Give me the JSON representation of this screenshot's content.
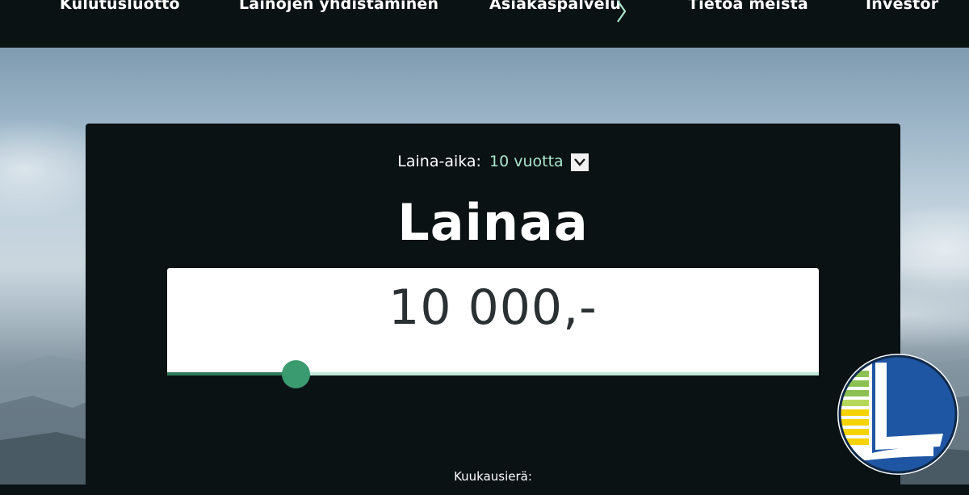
{
  "nav": {
    "items": [
      {
        "label": "Kulutusluotto"
      },
      {
        "label": "Lainojen yhdistäminen"
      },
      {
        "label": "Asiakaspalvelu"
      },
      {
        "label": "Tietoa meistä"
      },
      {
        "label": "Investor"
      }
    ],
    "chevron_icon": "chevron-right-icon",
    "chevron_color": "#a9e5cc"
  },
  "calculator": {
    "term_label": "Laina-aika:",
    "term_value": "10 vuotta",
    "title": "Lainaa",
    "amount": "10 000,-",
    "slider_fraction": 0.197,
    "monthly_label": "Kuukausierä:",
    "accent_color": "#3a9a70"
  },
  "logo": {
    "icon": "lender-logo-icon",
    "colors": [
      "#1f56a3",
      "#f5d300",
      "#8cc152",
      "#ffffff"
    ]
  }
}
